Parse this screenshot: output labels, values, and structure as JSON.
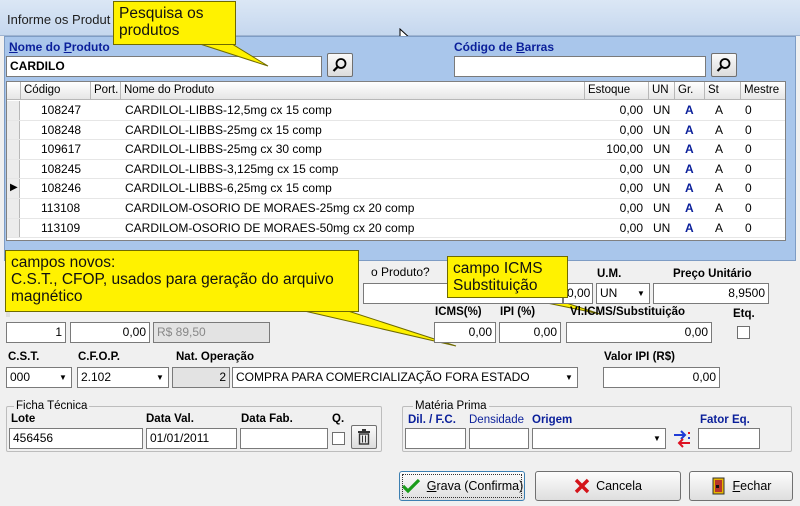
{
  "window": {
    "title": "Informe os Produt"
  },
  "callouts": {
    "pesquisa": "Pesquisa os produtos",
    "campos_novos": "campos novos:\nC.S.T., CFOP, usados para geração do arquivo magnético",
    "icms_sub": "campo ICMS Substituição"
  },
  "search": {
    "nome_label": "Nome do Produto",
    "nome_value": "CARDILO",
    "barras_label": "Código de Barras",
    "barras_value": ""
  },
  "grid": {
    "columns": [
      "Código",
      "Port.",
      "Nome do Produto",
      "Estoque",
      "UN",
      "Gr.",
      "St",
      "Mestre"
    ],
    "rows": [
      {
        "codigo": "108247",
        "port": "",
        "nome": "CARDILOL-LIBBS-12,5mg cx 15 comp",
        "estoque": "0,00",
        "un": "UN",
        "gr": "A",
        "st": "A",
        "mestre": "0"
      },
      {
        "codigo": "108248",
        "port": "",
        "nome": "CARDILOL-LIBBS-25mg cx 15 comp",
        "estoque": "0,00",
        "un": "UN",
        "gr": "A",
        "st": "A",
        "mestre": "0"
      },
      {
        "codigo": "109617",
        "port": "",
        "nome": "CARDILOL-LIBBS-25mg cx 30 comp",
        "estoque": "100,00",
        "un": "UN",
        "gr": "A",
        "st": "A",
        "mestre": "0"
      },
      {
        "codigo": "108245",
        "port": "",
        "nome": "CARDILOL-LIBBS-3,125mg cx 15 comp",
        "estoque": "0,00",
        "un": "UN",
        "gr": "A",
        "st": "A",
        "mestre": "0"
      },
      {
        "codigo": "108246",
        "port": "",
        "nome": "CARDILOL-LIBBS-6,25mg cx 15 comp",
        "estoque": "0,00",
        "un": "UN",
        "gr": "A",
        "st": "A",
        "mestre": "0"
      },
      {
        "codigo": "113108",
        "port": "",
        "nome": "CARDILOM-OSORIO DE MORAES-25mg cx 20 comp",
        "estoque": "0,00",
        "un": "UN",
        "gr": "A",
        "st": "A",
        "mestre": "0"
      },
      {
        "codigo": "113109",
        "port": "",
        "nome": "CARDILOM-OSORIO DE MORAES-50mg cx 20 comp",
        "estoque": "0,00",
        "un": "UN",
        "gr": "A",
        "st": "A",
        "mestre": "0"
      }
    ]
  },
  "form": {
    "produto_q": "o Produto?",
    "um_label": "U.M.",
    "preco_label": "Preço Unitário",
    "partial_value": "0,00",
    "um_value": "UN",
    "preco_value": "8,9500",
    "qtd_value": "1",
    "desc_value": "0,00",
    "total_value": "R$ 89,50",
    "icms_label": "ICMS(%)",
    "ipi_label": "IPI (%)",
    "vl_icms_label": "Vl.ICMS/Substituição",
    "etq_label": "Etq.",
    "icms_value": "0,00",
    "ipi_value": "0,00",
    "vl_icms_value": "0,00",
    "cst_label": "C.S.T.",
    "cfop_label": "C.F.O.P.",
    "nat_label": "Nat. Operação",
    "valor_ipi_label": "Valor IPI (R$)",
    "cst_value": "000",
    "cfop_value": "2.102",
    "nat_code": "2",
    "nat_value": "COMPRA PARA COMERCIALIZAÇÃO FORA ESTADO",
    "valor_ipi_value": "0,00"
  },
  "ficha": {
    "legend": "Ficha Técnica",
    "lote_label": "Lote",
    "dataval_label": "Data Val.",
    "datafab_label": "Data Fab.",
    "q_label": "Q.",
    "lote_value": "456456",
    "dataval_value": "01/01/2011",
    "datafab_value": ""
  },
  "materia": {
    "legend": "Matéria Prima",
    "dil_label": "Dil. / F.C.",
    "densidade_label": "Densidade",
    "origem_label": "Origem",
    "fator_label": "Fator Eq."
  },
  "buttons": {
    "grava": "Grava (Confirma)",
    "cancela": "Cancela",
    "fechar": "Fechar"
  }
}
